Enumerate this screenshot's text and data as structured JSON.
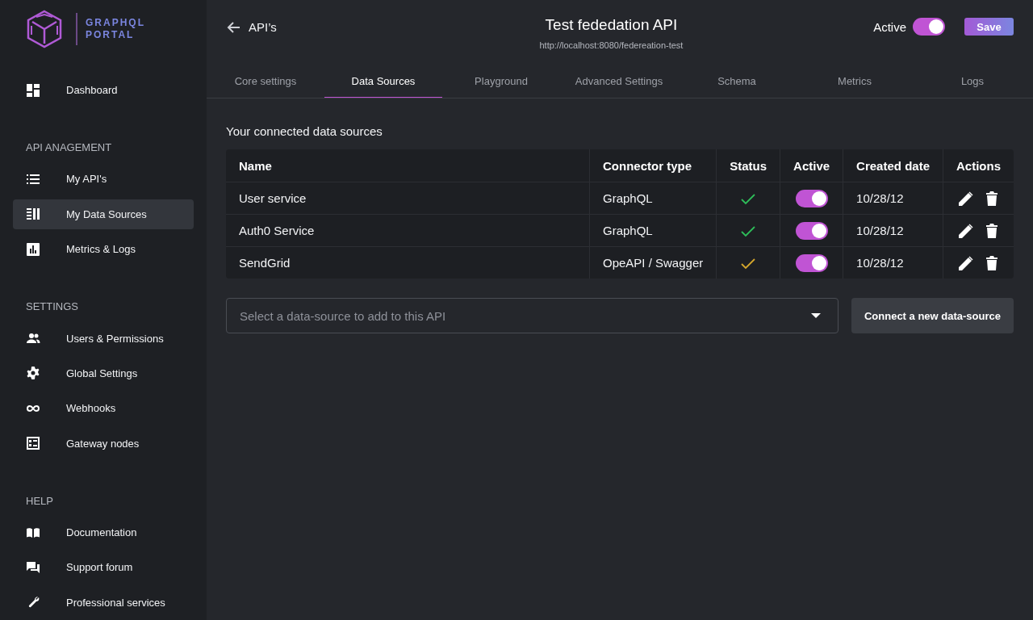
{
  "logo": {
    "line1": "GRAPHQL",
    "line2": "PORTAL"
  },
  "sidebar": {
    "sections": [
      {
        "items": [
          {
            "label": "Dashboard",
            "selected": false
          }
        ]
      },
      {
        "heading": "API ANAGEMENT",
        "items": [
          {
            "label": "My API's",
            "selected": false
          },
          {
            "label": "My Data Sources",
            "selected": true
          },
          {
            "label": "Metrics & Logs",
            "selected": false
          }
        ]
      },
      {
        "heading": "SETTINGS",
        "items": [
          {
            "label": "Users & Permissions",
            "selected": false
          },
          {
            "label": "Global Settings",
            "selected": false
          },
          {
            "label": "Webhooks",
            "selected": false
          },
          {
            "label": "Gateway nodes",
            "selected": false
          }
        ]
      },
      {
        "heading": "HELP",
        "items": [
          {
            "label": "Documentation",
            "selected": false
          },
          {
            "label": "Support forum",
            "selected": false
          },
          {
            "label": "Professional services",
            "selected": false
          }
        ]
      }
    ]
  },
  "header": {
    "back": "API’s",
    "title": "Test fededation API",
    "url": "http://localhost:8080/federeation-test",
    "active_label": "Active",
    "active_on": true,
    "save": "Save"
  },
  "tabs": [
    {
      "label": "Core settings",
      "selected": false
    },
    {
      "label": "Data Sources",
      "selected": true
    },
    {
      "label": "Playground",
      "selected": false
    },
    {
      "label": "Advanced Settings",
      "selected": false
    },
    {
      "label": "Schema",
      "selected": false
    },
    {
      "label": "Metrics",
      "selected": false
    },
    {
      "label": "Logs",
      "selected": false
    }
  ],
  "section_title": "Your connected data sources",
  "table": {
    "columns": [
      "Name",
      "Connector type",
      "Status",
      "Active",
      "Created date",
      "Actions"
    ],
    "rows": [
      {
        "name": "User service",
        "connector": "GraphQL",
        "color": "#2ebd59",
        "on": true,
        "date": "10/28/12"
      },
      {
        "name": "Auth0 Service",
        "connector": "GraphQL",
        "color": "#2ebd59",
        "on": true,
        "date": "10/28/12"
      },
      {
        "name": "SendGrid",
        "connector": "OpeAPI / Swagger",
        "color": "#d4a72c",
        "on": true,
        "date": "10/28/12"
      }
    ]
  },
  "select": {
    "placeholder": "Select a data-source to add to this API"
  },
  "connect_button": "Connect a new data-source"
}
